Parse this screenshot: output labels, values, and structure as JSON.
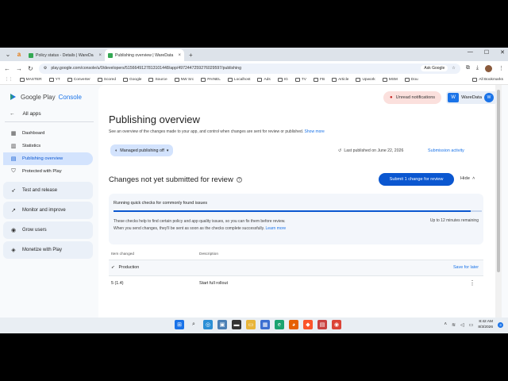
{
  "browser": {
    "tabs": [
      {
        "label": "Policy status - Details | WareDa",
        "active": false
      },
      {
        "label": "Publishing overview | WareData",
        "active": true
      }
    ],
    "url": "play.google.com/console/u/0/developers/5156649127813101448/app/4972447259276029597/publishing",
    "ask_google": "Ask Google",
    "bookmarks": [
      "MASTER",
      "YT",
      "Converter",
      "Scored",
      "Google",
      "Source",
      "NW Src",
      "PAINEL",
      "Localhost",
      "Ads",
      "IG",
      "TV",
      "FB",
      "Article",
      "Upwork",
      "MSM",
      "Dou"
    ],
    "all_bookmarks": "All Bookmarks"
  },
  "sidebar": {
    "brand_google": "Google Play",
    "brand_console": "Console",
    "all_apps": "All apps",
    "items": [
      {
        "label": "Dashboard",
        "icon": "dashboard-icon"
      },
      {
        "label": "Statistics",
        "icon": "bar-chart-icon"
      },
      {
        "label": "Publishing overview",
        "icon": "publish-icon",
        "active": true
      },
      {
        "label": "Protected with Play",
        "icon": "shield-icon"
      }
    ],
    "groups": [
      {
        "label": "Test and release",
        "icon": "rocket-icon"
      },
      {
        "label": "Monitor and improve",
        "icon": "trend-icon"
      },
      {
        "label": "Grow users",
        "icon": "users-icon"
      },
      {
        "label": "Monetize with Play",
        "icon": "tag-icon"
      }
    ]
  },
  "header": {
    "unread": "Unread notifications",
    "account": "WareData"
  },
  "main": {
    "title": "Publishing overview",
    "description": "See an overview of the changes made to your app, and control when changes are sent for review or published.",
    "show_more": "Show more",
    "managed_publishing": "Managed publishing off",
    "last_published": "Last published on June 22, 2026",
    "submission_activity": "Submission activity",
    "changes_title": "Changes not yet submitted for review",
    "submit_button": "Submit 1 change for review",
    "hide": "Hide",
    "checks": {
      "title": "Running quick checks for commonly found issues",
      "progress": 0.97,
      "body_line1": "These checks help to find certain policy and app quality issues, so you can fix them before review.",
      "body_line2": "When you send changes, they'll be sent as soon as the checks complete successfully.",
      "learn_more": "Learn more",
      "time_remaining": "Up to 12 minutes remaining"
    },
    "table": {
      "headers": [
        "Item changed",
        "Description"
      ],
      "group_label": "Production",
      "save_for_later": "Save for later",
      "rows": [
        {
          "item": "5 (1.4)",
          "description": "Start full rollout"
        }
      ]
    }
  },
  "taskbar": {
    "time": "8:42 AM",
    "date": "8/3/2026",
    "notification_count": "3"
  },
  "colors": {
    "accent": "#0b57d0",
    "active_nav": "#d3e3fd",
    "unread_bg": "#fbe0dd"
  }
}
